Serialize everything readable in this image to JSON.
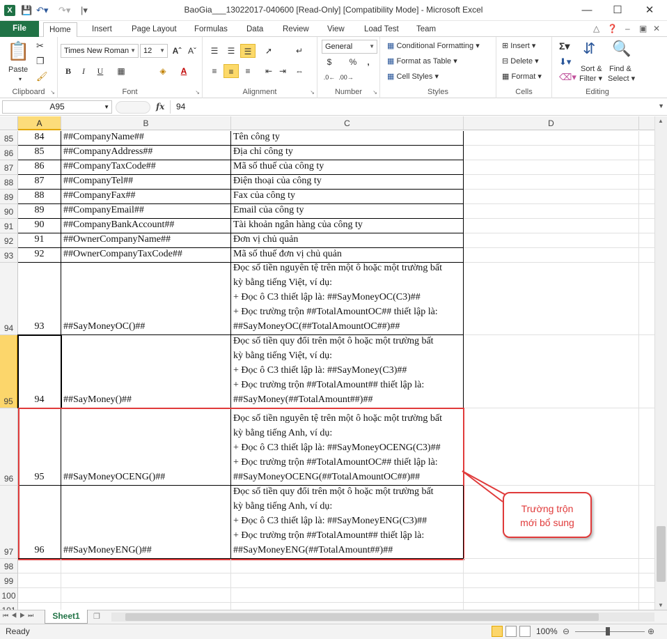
{
  "window": {
    "title": "BaoGia___13022017-040600  [Read-Only]  [Compatibility Mode]  -  Microsoft Excel",
    "app_icon": "X",
    "minimize": "—",
    "maximize": "☐",
    "close": "✕"
  },
  "tabs": [
    "File",
    "Home",
    "Insert",
    "Page Layout",
    "Formulas",
    "Data",
    "Review",
    "View",
    "Load Test",
    "Team"
  ],
  "ribbon": {
    "clipboard": {
      "label": "Clipboard",
      "paste": "Paste"
    },
    "font": {
      "label": "Font",
      "name": "Times New Roman",
      "size": "12",
      "bold": "B",
      "italic": "I",
      "underline": "U"
    },
    "alignment": {
      "label": "Alignment"
    },
    "number": {
      "label": "Number",
      "format": "General",
      "currency": "$",
      "percent": "%",
      "comma": ","
    },
    "styles": {
      "label": "Styles",
      "conditional": "Conditional Formatting",
      "format_table": "Format as Table",
      "cell_styles": "Cell Styles"
    },
    "cells": {
      "label": "Cells",
      "insert": "Insert",
      "delete": "Delete",
      "format": "Format"
    },
    "editing": {
      "label": "Editing",
      "sort": "Sort &",
      "sort2": "Filter",
      "find": "Find &",
      "find2": "Select"
    }
  },
  "formula_bar": {
    "name_box": "A95",
    "fx": "fx",
    "content": "94"
  },
  "columns": [
    "A",
    "B",
    "C",
    "D"
  ],
  "rows": [
    {
      "n": "85",
      "a": "84",
      "b": "##CompanyName##",
      "c": "Tên công ty"
    },
    {
      "n": "86",
      "a": "85",
      "b": "##CompanyAddress##",
      "c": "Địa chỉ công ty"
    },
    {
      "n": "87",
      "a": "86",
      "b": "##CompanyTaxCode##",
      "c": "Mã số thuế của công ty"
    },
    {
      "n": "88",
      "a": "87",
      "b": "##CompanyTel##",
      "c": "Điện thoại của công ty"
    },
    {
      "n": "89",
      "a": "88",
      "b": "##CompanyFax##",
      "c": "Fax của công ty"
    },
    {
      "n": "90",
      "a": "89",
      "b": "##CompanyEmail##",
      "c": "Email của công ty"
    },
    {
      "n": "91",
      "a": "90",
      "b": "##CompanyBankAccount##",
      "c": "Tài khoản ngân hàng của công ty"
    },
    {
      "n": "92",
      "a": "91",
      "b": "##OwnerCompanyName##",
      "c": "Đơn vị chủ quản"
    },
    {
      "n": "93",
      "a": "92",
      "b": "##OwnerCompanyTaxCode##",
      "c": "Mã số thuế đơn vị chủ quản"
    },
    {
      "n": "94",
      "a": "93",
      "b": "##SayMoneyOC()##",
      "c": "Đọc số tiền nguyên tệ trên một ô hoặc một trường bất\nkỳ bằng tiếng Việt, ví dụ:\n+ Đọc ô C3 thiết lập là: ##SayMoneyOC(C3)##\n+ Đọc trường trộn ##TotalAmountOC## thiết lập là:\n##SayMoneyOC(##TotalAmountOC##)##"
    },
    {
      "n": "95",
      "a": "94",
      "b": "##SayMoney()##",
      "c": "Đọc số tiền quy đổi trên một ô hoặc một trường bất\nkỳ bằng tiếng Việt, ví dụ:\n+ Đọc ô C3 thiết lập là: ##SayMoney(C3)##\n+ Đọc trường trộn ##TotalAmount## thiết lập là:\n##SayMoney(##TotalAmount##)##"
    },
    {
      "n": "96",
      "a": "95",
      "b": "##SayMoneyOCENG()##",
      "c": "Đọc số tiền nguyên tệ trên một ô hoặc một trường bất\nkỳ bằng tiếng Anh, ví dụ:\n+ Đọc ô C3 thiết lập là: ##SayMoneyOCENG(C3)##\n+ Đọc trường trộn ##TotalAmountOC## thiết lập là:\n##SayMoneyOCENG(##TotalAmountOC##)##"
    },
    {
      "n": "97",
      "a": "96",
      "b": "##SayMoneyENG()##",
      "c": "Đọc số tiền quy đổi trên một ô hoặc một trường bất\nkỳ bằng tiếng Anh, ví dụ:\n+ Đọc ô C3 thiết lập là: ##SayMoneyENG(C3)##\n+ Đọc trường trộn ##TotalAmount## thiết lập là:\n##SayMoneyENG(##TotalAmount##)##"
    },
    {
      "n": "98",
      "a": "",
      "b": "",
      "c": ""
    },
    {
      "n": "99",
      "a": "",
      "b": "",
      "c": ""
    },
    {
      "n": "100",
      "a": "",
      "b": "",
      "c": ""
    },
    {
      "n": "101",
      "a": "",
      "b": "",
      "c": ""
    }
  ],
  "callout": {
    "line1": "Trường trộn",
    "line2": "mới bổ sung",
    "color": "#e03a3a"
  },
  "sheet_tab": "Sheet1",
  "status": {
    "text": "Ready",
    "zoom": "100%"
  }
}
